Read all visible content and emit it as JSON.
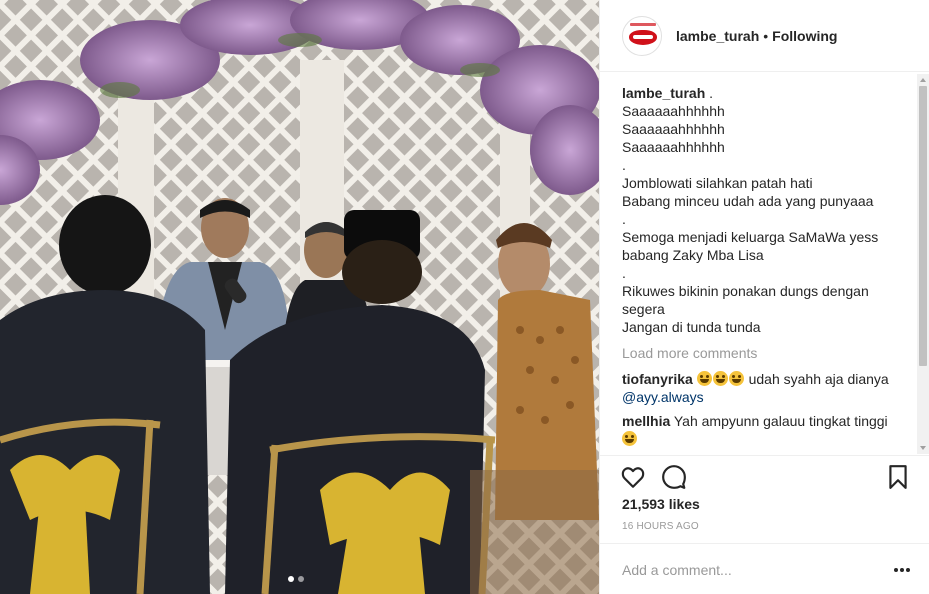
{
  "header": {
    "username": "lambe_turah",
    "separator": "•",
    "follow_status": "Following",
    "avatar_icon": "lips-logo-icon"
  },
  "caption": {
    "username": "lambe_turah",
    "first_line": " .",
    "lines": [
      "Saaaaaahhhhhh",
      "Saaaaaahhhhhh",
      "Saaaaaahhhhhh",
      ".",
      "Jomblowati silahkan patah hati",
      "Babang minceu udah ada yang punyaaa",
      ".",
      "Semoga menjadi keluarga SaMaWa yess",
      "babang Zaky Mba Lisa",
      ".",
      "Rikuwes bikinin ponakan dungs dengan",
      "segera",
      "Jangan di tunda tunda"
    ]
  },
  "load_more": "Load more comments",
  "comments": [
    {
      "username": "tiofanyrika",
      "emoji": [
        "face-with-tears-of-joy-icon",
        "face-with-tears-of-joy-icon",
        "face-with-tears-of-joy-icon"
      ],
      "text": " udah syahh aja dianya ",
      "mention": "@ayy.always"
    },
    {
      "username": "mellhia",
      "text": " Yah ampyunn galauu tingkat tinggi",
      "emoji": [
        "crying-face-icon"
      ]
    }
  ],
  "actions": {
    "like_icon": "heart-icon",
    "comment_icon": "comment-bubble-icon",
    "save_icon": "bookmark-icon"
  },
  "likes": "21,593 likes",
  "timestamp": "16 HOURS AGO",
  "add_comment": {
    "placeholder": "Add a comment..."
  },
  "carousel": {
    "total": 2,
    "active_index": 0
  },
  "colors": {
    "text": "#262626",
    "muted": "#999999",
    "mention": "#003569",
    "border": "#efefef",
    "brand_red": "#d0111a"
  }
}
